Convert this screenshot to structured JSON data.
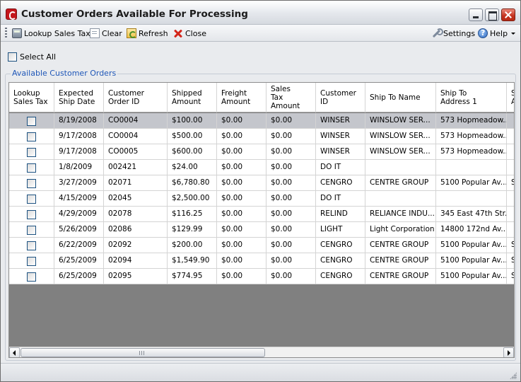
{
  "window": {
    "title": "Customer Orders Available For Processing"
  },
  "toolbar": {
    "lookup_label": "Lookup Sales Tax",
    "clear_label": "Clear",
    "refresh_label": "Refresh",
    "close_label": "Close",
    "settings_label": "Settings",
    "help_label": "Help"
  },
  "select_all": {
    "label": "Select All",
    "checked": false
  },
  "group": {
    "title": "Available Customer Orders"
  },
  "grid": {
    "columns": [
      [
        "Lookup",
        "Sales Tax"
      ],
      [
        "Expected",
        "Ship Date"
      ],
      [
        "Customer",
        "Order ID"
      ],
      [
        "Shipped",
        "Amount"
      ],
      [
        "Freight",
        "Amount"
      ],
      [
        "Sales",
        "Tax",
        "Amount"
      ],
      [
        "Customer",
        "ID"
      ],
      [
        "Ship To Name"
      ],
      [
        "Ship To",
        "Address 1"
      ],
      [
        "S",
        "A"
      ]
    ],
    "selected_row": 0,
    "rows": [
      [
        "",
        "8/19/2008",
        "CO0004",
        "$100.00",
        "$0.00",
        "$0.00",
        "WINSER",
        "WINSLOW SER...",
        "573 Hopmeadow...",
        ""
      ],
      [
        "",
        "9/17/2008",
        "CO0004",
        "$500.00",
        "$0.00",
        "$0.00",
        "WINSER",
        "WINSLOW SER...",
        "573 Hopmeadow...",
        ""
      ],
      [
        "",
        "9/17/2008",
        "CO0005",
        "$600.00",
        "$0.00",
        "$0.00",
        "WINSER",
        "WINSLOW SER...",
        "573 Hopmeadow...",
        ""
      ],
      [
        "",
        "1/8/2009",
        "002421",
        "$24.00",
        "$0.00",
        "$0.00",
        "DO IT",
        "",
        "",
        ""
      ],
      [
        "",
        "3/27/2009",
        "02071",
        "$6,780.80",
        "$0.00",
        "$0.00",
        "CENGRO",
        "CENTRE GROUP",
        "5100 Popular Av...",
        "S"
      ],
      [
        "",
        "4/15/2009",
        "02045",
        "$2,500.00",
        "$0.00",
        "$0.00",
        "DO IT",
        "",
        "",
        ""
      ],
      [
        "",
        "4/29/2009",
        "02078",
        "$116.25",
        "$0.00",
        "$0.00",
        "RELIND",
        "RELIANCE INDU...",
        "345 East 47th Str...",
        ""
      ],
      [
        "",
        "5/26/2009",
        "02086",
        "$129.99",
        "$0.00",
        "$0.00",
        "LIGHT",
        "Light Corporation",
        "14800 172nd Av...",
        ""
      ],
      [
        "",
        "6/22/2009",
        "02092",
        "$200.00",
        "$0.00",
        "$0.00",
        "CENGRO",
        "CENTRE GROUP",
        "5100 Popular Av...",
        "S"
      ],
      [
        "",
        "6/25/2009",
        "02094",
        "$1,549.90",
        "$0.00",
        "$0.00",
        "CENGRO",
        "CENTRE GROUP",
        "5100 Popular Av...",
        "S"
      ],
      [
        "",
        "6/25/2009",
        "02095",
        "$774.95",
        "$0.00",
        "$0.00",
        "CENGRO",
        "CENTRE GROUP",
        "5100 Popular Av...",
        "S"
      ]
    ]
  }
}
